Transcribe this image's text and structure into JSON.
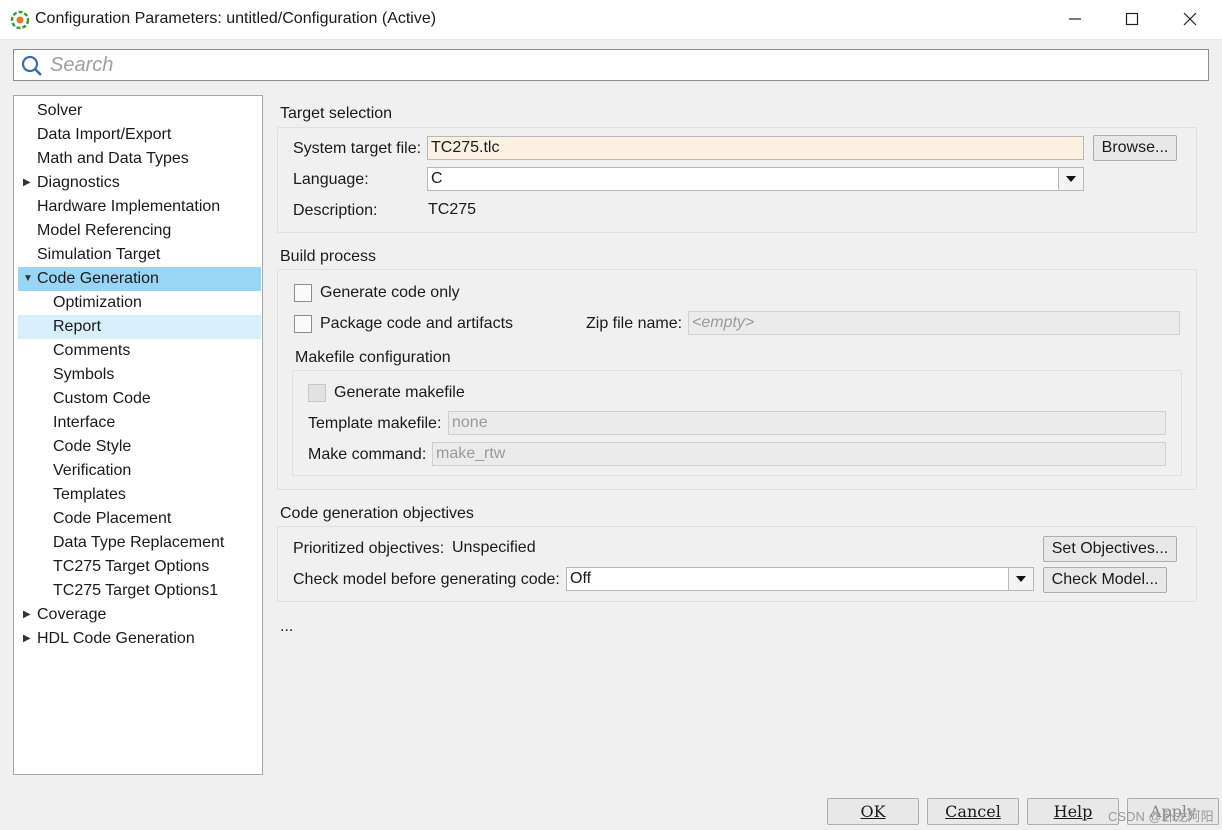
{
  "window": {
    "title": "Configuration Parameters: untitled/Configuration (Active)"
  },
  "search": {
    "placeholder": "Search"
  },
  "tree": {
    "items": [
      {
        "label": "Solver"
      },
      {
        "label": "Data Import/Export"
      },
      {
        "label": "Math and Data Types"
      },
      {
        "label": "Diagnostics"
      },
      {
        "label": "Hardware Implementation"
      },
      {
        "label": "Model Referencing"
      },
      {
        "label": "Simulation Target"
      },
      {
        "label": "Code Generation"
      },
      {
        "label": "Optimization"
      },
      {
        "label": "Report"
      },
      {
        "label": "Comments"
      },
      {
        "label": "Symbols"
      },
      {
        "label": "Custom Code"
      },
      {
        "label": "Interface"
      },
      {
        "label": "Code Style"
      },
      {
        "label": "Verification"
      },
      {
        "label": "Templates"
      },
      {
        "label": "Code Placement"
      },
      {
        "label": "Data Type Replacement"
      },
      {
        "label": "TC275 Target Options"
      },
      {
        "label": "TC275 Target Options1"
      },
      {
        "label": "Coverage"
      },
      {
        "label": "HDL Code Generation"
      }
    ]
  },
  "target_selection": {
    "title": "Target selection",
    "system_target_label": "System target file:",
    "system_target_value": "TC275.tlc",
    "browse_label": "Browse...",
    "language_label": "Language:",
    "language_value": "C",
    "description_label": "Description:",
    "description_value": "TC275"
  },
  "build_process": {
    "title": "Build process",
    "generate_code_only": "Generate code only",
    "package_code": "Package code and artifacts",
    "zip_label": "Zip file name:",
    "zip_placeholder": "<empty>",
    "makefile_title": "Makefile configuration",
    "generate_makefile": "Generate makefile",
    "template_label": "Template makefile:",
    "template_value": "none",
    "make_command_label": "Make command:",
    "make_command_value": "make_rtw"
  },
  "objectives": {
    "title": "Code generation objectives",
    "prioritized_label": "Prioritized objectives:",
    "prioritized_value": "Unspecified",
    "set_objectives_label": "Set Objectives...",
    "check_label": "Check model before generating code:",
    "check_value": "Off",
    "check_model_label": "Check Model..."
  },
  "ellipsis": "...",
  "footer": {
    "ok": "OK",
    "cancel": "Cancel",
    "help": "Help",
    "apply": "Apply",
    "watermark": "CSDN @卧龙阿阳"
  },
  "colors": {
    "selected_row": "#99d5f5",
    "hover_row": "#d7eefb",
    "target_field_bg": "#fcf0e3"
  }
}
